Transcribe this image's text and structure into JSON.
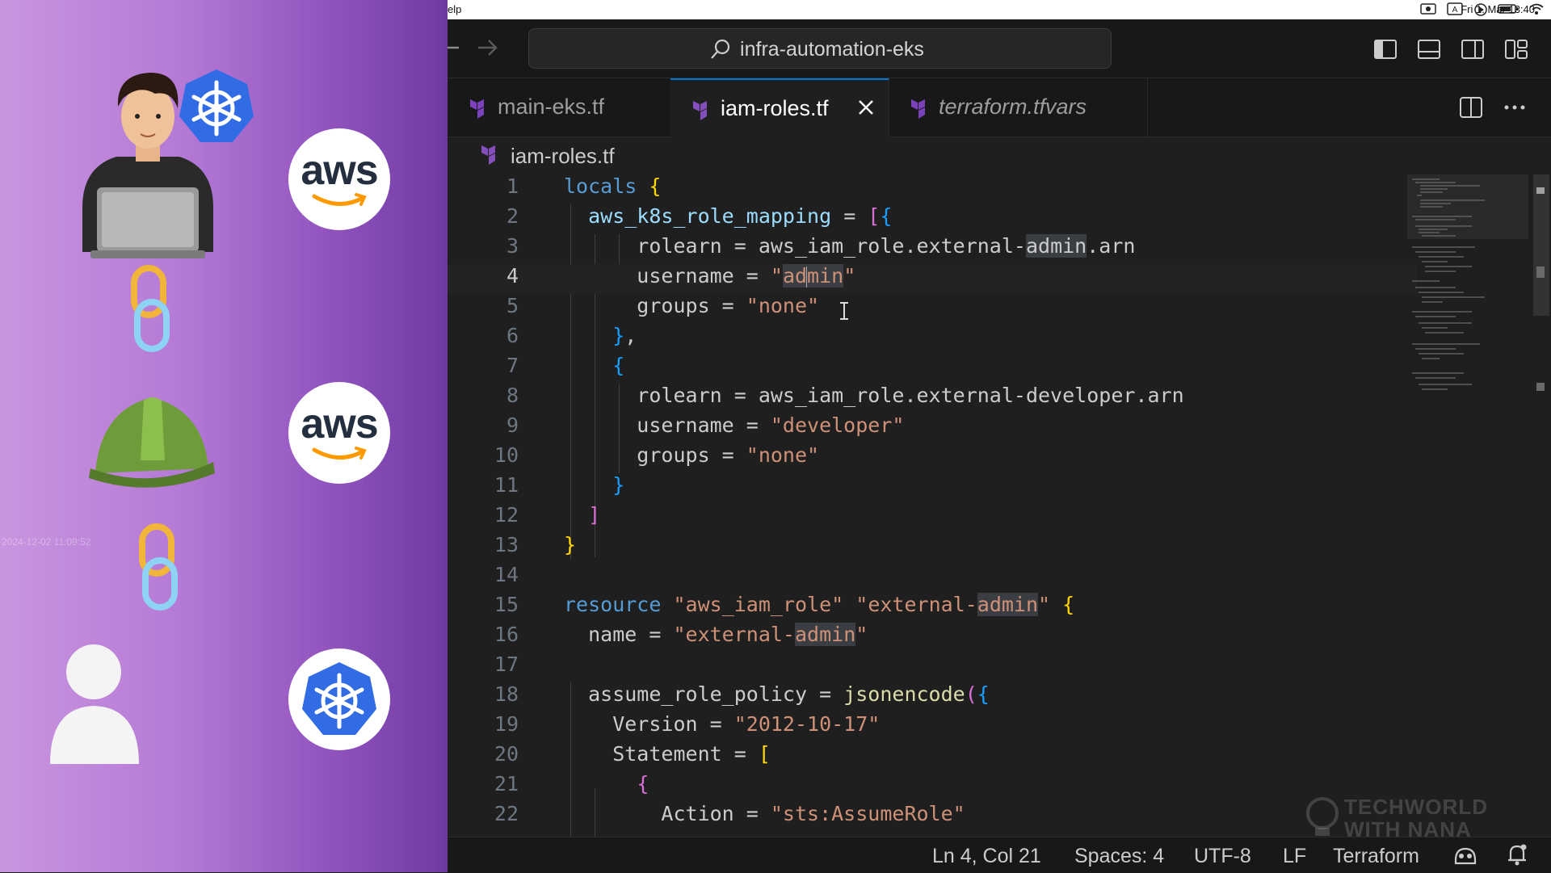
{
  "menubar": {
    "app_fragment": "elp",
    "clock": "Fri 1. Mar  13:40"
  },
  "search": {
    "label": "infra-automation-eks"
  },
  "tabs": [
    {
      "label": "main-eks.tf",
      "active": false,
      "italic": false
    },
    {
      "label": "iam-roles.tf",
      "active": true,
      "italic": false
    },
    {
      "label": "terraform.tfvars",
      "active": false,
      "italic": true
    }
  ],
  "breadcrumb": {
    "file": "iam-roles.tf"
  },
  "editor": {
    "current_line": 4,
    "lines": [
      {
        "n": "1",
        "tokens": [
          [
            "kw",
            "locals"
          ],
          [
            "p",
            " "
          ],
          [
            "b1",
            "{"
          ]
        ]
      },
      {
        "n": "2",
        "tokens": [
          [
            "p",
            "  "
          ],
          [
            "attr",
            "aws_k8s_role_mapping"
          ],
          [
            "p",
            " = "
          ],
          [
            "b2",
            "["
          ],
          [
            "b3",
            "{"
          ]
        ]
      },
      {
        "n": "3",
        "tokens": [
          [
            "p",
            "      rolearn = "
          ],
          [
            "ref",
            "aws_iam_role.external-"
          ],
          [
            "hl",
            "admin"
          ],
          [
            "ref",
            ".arn"
          ]
        ]
      },
      {
        "n": "4",
        "tokens": [
          [
            "p",
            "      username = "
          ],
          [
            "str",
            "\""
          ],
          [
            "hl",
            "ad"
          ],
          [
            "cursor",
            ""
          ],
          [
            "hl",
            "min"
          ],
          [
            "str",
            "\""
          ]
        ]
      },
      {
        "n": "5",
        "tokens": [
          [
            "p",
            "      groups = "
          ],
          [
            "str",
            "\"none\""
          ]
        ]
      },
      {
        "n": "6",
        "tokens": [
          [
            "p",
            "    "
          ],
          [
            "b3",
            "}"
          ],
          [
            "p",
            ","
          ]
        ]
      },
      {
        "n": "7",
        "tokens": [
          [
            "p",
            "    "
          ],
          [
            "b3",
            "{"
          ]
        ]
      },
      {
        "n": "8",
        "tokens": [
          [
            "p",
            "      rolearn = "
          ],
          [
            "ref",
            "aws_iam_role.external-developer.arn"
          ]
        ]
      },
      {
        "n": "9",
        "tokens": [
          [
            "p",
            "      username = "
          ],
          [
            "str",
            "\"developer\""
          ]
        ]
      },
      {
        "n": "10",
        "tokens": [
          [
            "p",
            "      groups = "
          ],
          [
            "str",
            "\"none\""
          ]
        ]
      },
      {
        "n": "11",
        "tokens": [
          [
            "p",
            "    "
          ],
          [
            "b3",
            "}"
          ]
        ]
      },
      {
        "n": "12",
        "tokens": [
          [
            "p",
            "  "
          ],
          [
            "b2",
            "]"
          ]
        ]
      },
      {
        "n": "13",
        "tokens": [
          [
            "b1",
            "}"
          ]
        ]
      },
      {
        "n": "14",
        "tokens": []
      },
      {
        "n": "15",
        "tokens": [
          [
            "kw",
            "resource"
          ],
          [
            "p",
            " "
          ],
          [
            "str",
            "\"aws_iam_role\""
          ],
          [
            "p",
            " "
          ],
          [
            "str",
            "\"external-"
          ],
          [
            "hl",
            "admin"
          ],
          [
            "str",
            "\""
          ],
          [
            "p",
            " "
          ],
          [
            "b1",
            "{"
          ]
        ]
      },
      {
        "n": "16",
        "tokens": [
          [
            "p",
            "  name = "
          ],
          [
            "str",
            "\"external-"
          ],
          [
            "hl",
            "admin"
          ],
          [
            "str",
            "\""
          ]
        ]
      },
      {
        "n": "17",
        "tokens": []
      },
      {
        "n": "18",
        "tokens": [
          [
            "p",
            "  assume_role_policy = "
          ],
          [
            "fn",
            "jsonencode"
          ],
          [
            "b2",
            "("
          ],
          [
            "b3",
            "{"
          ]
        ]
      },
      {
        "n": "19",
        "tokens": [
          [
            "p",
            "    Version = "
          ],
          [
            "str",
            "\"2012-10-17\""
          ]
        ]
      },
      {
        "n": "20",
        "tokens": [
          [
            "p",
            "    Statement = "
          ],
          [
            "b1",
            "["
          ]
        ]
      },
      {
        "n": "21",
        "tokens": [
          [
            "p",
            "      "
          ],
          [
            "b2",
            "{"
          ]
        ]
      },
      {
        "n": "22",
        "tokens": [
          [
            "p",
            "        Action = "
          ],
          [
            "str",
            "\"sts:AssumeRole\""
          ]
        ]
      }
    ]
  },
  "watermark": {
    "line1": "TECHWORLD",
    "line2": "WITH NANA"
  },
  "status": {
    "position": "Ln 4, Col 21",
    "spaces": "Spaces: 4",
    "encoding": "UTF-8",
    "eol": "LF",
    "language": "Terraform"
  },
  "left_panel": {
    "timestamp": "2024-12-02 11:09:52"
  },
  "colors": {
    "accent": "#0078d4",
    "aws_orange": "#ff9900",
    "k8s_blue": "#326ce5",
    "terraform_purple": "#7b42bc"
  },
  "icons": [
    "terraform-file-icon",
    "search-icon",
    "close-icon",
    "split-editor-icon",
    "more-icon",
    "copilot-icon",
    "bell-icon",
    "kubernetes-icon",
    "aws-logo",
    "chain-link-icon",
    "hard-hat-icon",
    "person-icon"
  ]
}
